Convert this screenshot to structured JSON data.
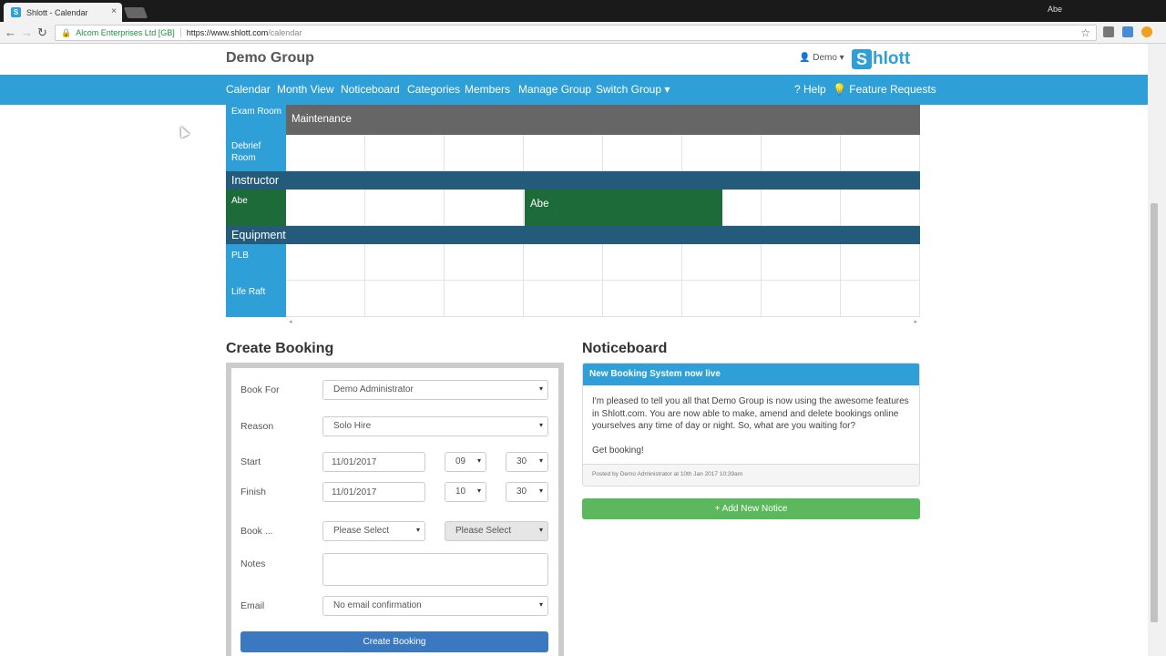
{
  "browser": {
    "tab_title": "Shlott - Calendar",
    "tab_favicon": "S",
    "tab_close": "×",
    "os_user": "Abe",
    "site_org": "Alcom Enterprises Ltd [GB]",
    "url_host": "https://www.shlott.com",
    "url_path": "/calendar",
    "back_glyph": "←",
    "forward_glyph": "→",
    "reload_glyph": "↻",
    "star_glyph": "☆",
    "lock_glyph": "🔒"
  },
  "header": {
    "group_title": "Demo Group",
    "user_menu": "👤 Demo ▾",
    "logo_letter": "S",
    "logo_text": "hlott"
  },
  "nav": {
    "items": [
      "Calendar",
      "Month View",
      "Noticeboard",
      "Categories",
      "Members",
      "Manage Group",
      "Switch Group ▾"
    ],
    "help": "? Help",
    "feature_requests": "💡 Feature Requests"
  },
  "calendar": {
    "rows": [
      {
        "label": "Exam Room"
      },
      {
        "label": "Debrief Room"
      },
      {
        "label": "Abe"
      },
      {
        "label": "PLB"
      },
      {
        "label": "Life Raft"
      }
    ],
    "categories": [
      "Instructor",
      "Equipment"
    ],
    "bookings": [
      "Maintenance",
      "Abe"
    ],
    "scroll_left": "◂",
    "scroll_right": "▸",
    "colors": {
      "resource": "#2f9fd8",
      "category": "#245a7a",
      "maintenance": "#666666",
      "booked": "#1e6b3a"
    }
  },
  "create_booking": {
    "title": "Create Booking",
    "fields": {
      "book_for_label": "Book For",
      "book_for_value": "Demo Administrator",
      "reason_label": "Reason",
      "reason_value": "Solo Hire",
      "start_label": "Start",
      "start_date": "11/01/2017",
      "start_hour": "09",
      "start_min": "30",
      "finish_label": "Finish",
      "finish_date": "11/01/2017",
      "finish_hour": "10",
      "finish_min": "30",
      "book_label": "Book ...",
      "book_select1": "Please Select",
      "book_select2": "Please Select",
      "notes_label": "Notes",
      "email_label": "Email",
      "email_value": "No email confirmation"
    },
    "caret": "▾",
    "submit": "Create Booking"
  },
  "noticeboard": {
    "title": "Noticeboard",
    "notice_title": "New Booking System now live",
    "notice_body": "I'm pleased to tell you all that Demo Group is now using the awesome features in Shlott.com. You are now able to make, amend and delete bookings online yourselves any time of day or night. So, what are you waiting for?",
    "notice_body2": "Get booking!",
    "notice_footer": "Posted by Demo Administrator at 10th Jan 2017 10:39am",
    "add_button": "+ Add New Notice"
  }
}
